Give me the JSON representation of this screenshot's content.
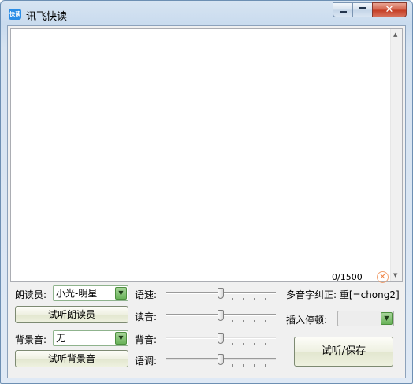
{
  "window": {
    "title": "讯飞快读",
    "icon_text": "快读"
  },
  "editor": {
    "text": "",
    "counter": "0/1500"
  },
  "left": {
    "reader_label": "朗读员:",
    "reader_value": "小光-明星",
    "preview_reader_button": "试听朗读员",
    "bgm_label": "背景音:",
    "bgm_value": "无",
    "preview_bgm_button": "试听背景音"
  },
  "sliders": {
    "speed_label": "语速:",
    "speed_level": 0.5,
    "volume_label": "读音:",
    "volume_level": 0.5,
    "bg_volume_label": "背音:",
    "bg_volume_level": 0.5,
    "pitch_label": "语调:",
    "pitch_level": 0.5
  },
  "right": {
    "polyphone_label": "多音字纠正: 重[=chong2]",
    "pause_label": "插入停顿:",
    "pause_value": "",
    "preview_save_button": "试听/保存"
  },
  "colors": {
    "accent_green": "#6ab35a",
    "close_red": "#c43c23",
    "clear_orange": "#f08040"
  }
}
